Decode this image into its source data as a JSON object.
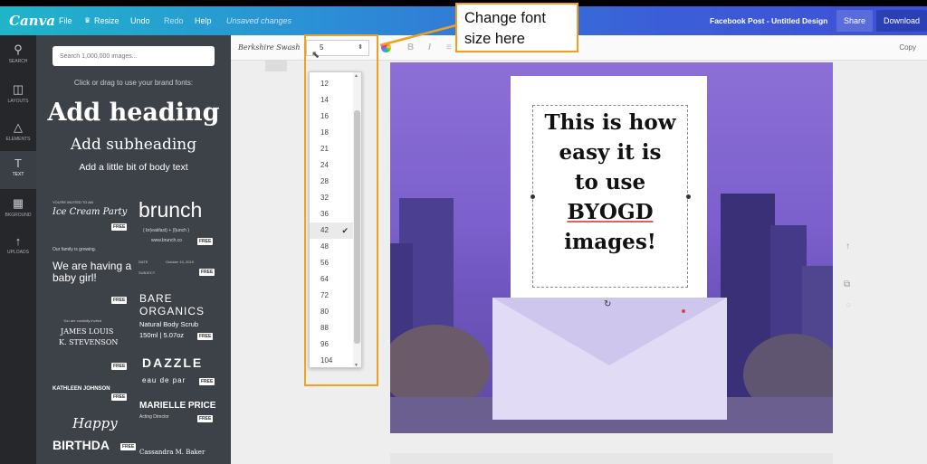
{
  "topbar": {
    "logo": "Canva",
    "menu": [
      "File",
      "Resize",
      "Undo",
      "Redo",
      "Help"
    ],
    "unsaved": "Unsaved changes",
    "design_title": "Facebook Post - Untitled Design",
    "share": "Share",
    "download": "Download"
  },
  "rail": [
    {
      "label": "SEARCH",
      "icon": "search-icon"
    },
    {
      "label": "LAYOUTS",
      "icon": "layouts-icon"
    },
    {
      "label": "ELEMENTS",
      "icon": "elements-icon"
    },
    {
      "label": "TEXT",
      "icon": "text-icon"
    },
    {
      "label": "BKGROUND",
      "icon": "background-icon"
    },
    {
      "label": "UPLOADS",
      "icon": "uploads-icon"
    }
  ],
  "panel": {
    "search_placeholder": "Search 1,000,000 images...",
    "brand_hint": "Click or drag to use your brand fonts:",
    "add_heading": "Add heading",
    "add_subheading": "Add subheading",
    "add_body": "Add a little bit of body text",
    "free": "FREE",
    "templates": {
      "ice_pre": "YOU'RE INVITED TO AN",
      "ice_main": "Ice Cream Party",
      "brunch": "brunch",
      "brunch_sub": "( br(eakfast) + (l)unch )",
      "brunch_url": "www.brunch.co",
      "family": "Our family is growing.",
      "baby": "We are having a baby girl!",
      "bare1": "BARE",
      "bare2": "ORGANICS",
      "scrub": "Natural Body Scrub",
      "scrub_size": "150ml | 5.07oz",
      "date_label": "DATE",
      "date_val": "October 10, 2019",
      "subject_label": "SUBJECT",
      "honored": "You are cordially invited",
      "james1": "JAMES LOUIS",
      "james2": "K. STEVENSON",
      "dazzle": "DAZZLE",
      "eau": "eau de par",
      "kathleen": "KATHLEEN JOHNSON",
      "marielle": "MARIELLE PRICE",
      "marielle_sub": "Acting Director",
      "happy": "Happy",
      "birthday": "BIRTHDA",
      "cassandra": "Cassandra M. Baker"
    }
  },
  "toolbar": {
    "font_name": "Berkshire Swash",
    "font_size_value": "5",
    "bold": "B",
    "italic": "I",
    "copy": "Copy"
  },
  "font_sizes": [
    "12",
    "14",
    "16",
    "18",
    "21",
    "24",
    "28",
    "32",
    "36",
    "42",
    "48",
    "56",
    "64",
    "72",
    "80",
    "88",
    "96",
    "104"
  ],
  "selected_size": "42",
  "canvas": {
    "lines": [
      "This is how",
      "easy it is",
      "to use",
      "BYOGD",
      "images!"
    ]
  },
  "callout": {
    "text": "Change font size here",
    "accent": "#f0a020"
  },
  "colors": {
    "topbar_start": "#1fb5c9",
    "topbar_end": "#3f4fd6",
    "panel": "#3d4148",
    "rail": "#25272b"
  }
}
